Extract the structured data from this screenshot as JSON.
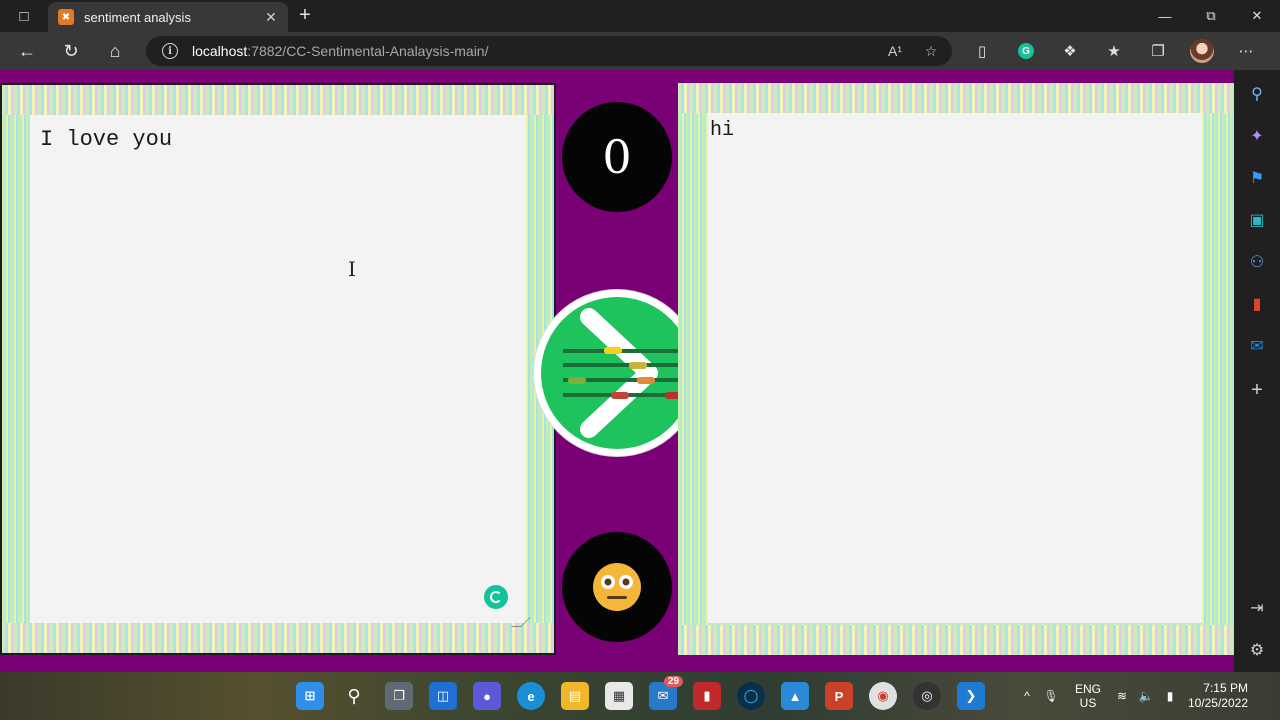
{
  "browser": {
    "tab_title": "sentiment analysis",
    "url_host": "localhost",
    "url_path": ":7882/CC-Sentimental-Analaysis-main/",
    "read_aloud_label": "A¹"
  },
  "page": {
    "input_text": "I love you",
    "output_text": "hi",
    "score": "0",
    "emoji": "neutral-face",
    "colors": {
      "background": "#7a0075",
      "button": "#1fc35e",
      "textarea": "#f3f3f3"
    }
  },
  "taskbar": {
    "mail_badge": "29",
    "language": "ENG",
    "region": "US",
    "time": "7:15 PM",
    "date": "10/25/2022"
  }
}
